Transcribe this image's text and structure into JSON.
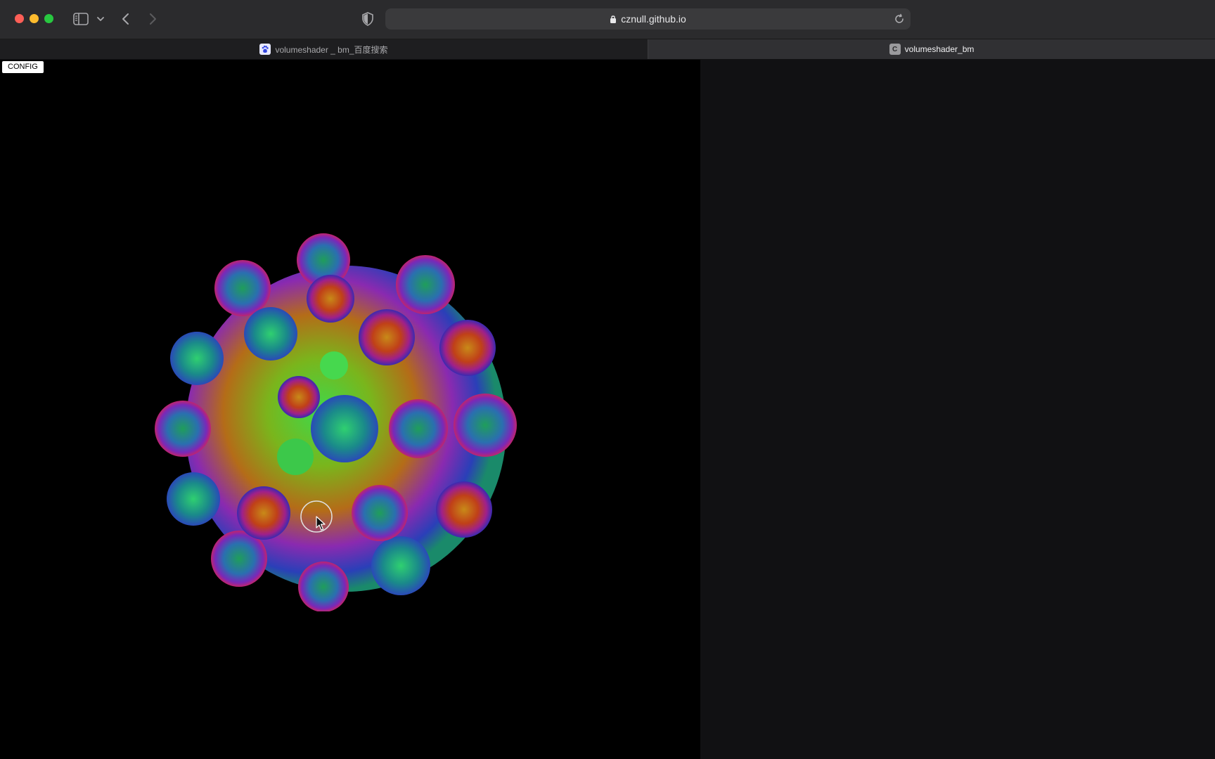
{
  "browser": {
    "url": "cznull.github.io",
    "icons": {
      "sidebar_toggle": "sidebar-icon",
      "sidebar_menu": "chevron-down-icon",
      "back": "chevron-left-icon",
      "forward": "chevron-right-icon",
      "privacy": "shield-icon",
      "secure": "lock-icon",
      "reload": "reload-icon"
    }
  },
  "tabs": [
    {
      "label": "volumeshader _ bm_百度搜索",
      "active": false,
      "favicon": "baidu-paw-icon"
    },
    {
      "label": "volumeshader_bm",
      "active": true,
      "favicon": "C"
    }
  ],
  "page": {
    "config_label": "CONFIG"
  },
  "colors": {
    "traffic_red": "#fe5f57",
    "traffic_yellow": "#febc2e",
    "traffic_green": "#28c840",
    "canvas_bg": "#000000",
    "page_bg": "#111113"
  }
}
